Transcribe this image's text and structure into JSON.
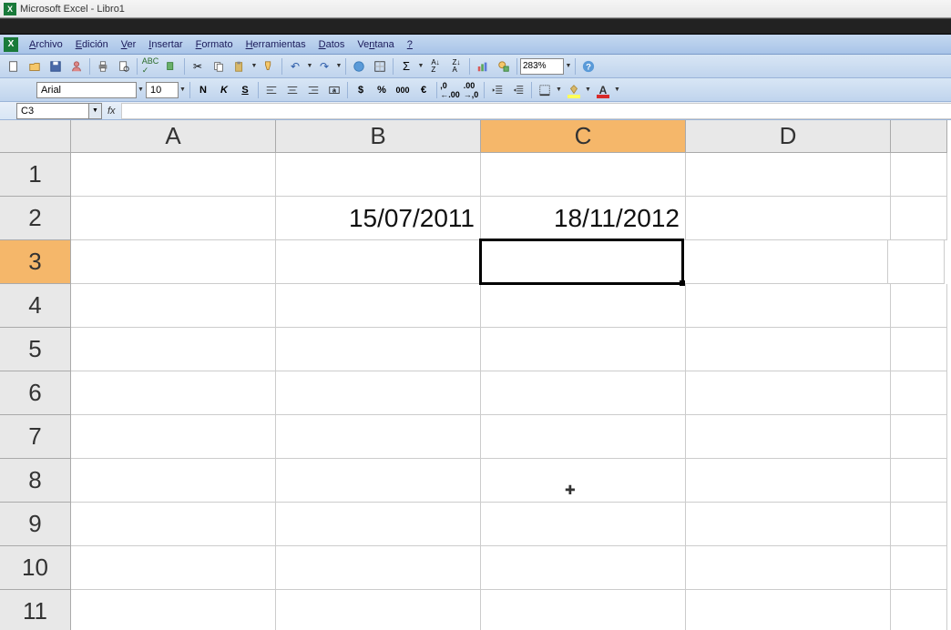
{
  "title": "Microsoft Excel - Libro1",
  "menus": [
    "Archivo",
    "Edición",
    "Ver",
    "Insertar",
    "Formato",
    "Herramientas",
    "Datos",
    "Ventana",
    "?"
  ],
  "zoom": "283%",
  "font": "Arial",
  "font_size": "10",
  "name_box": "C3",
  "formula": "",
  "columns": [
    "A",
    "B",
    "C",
    "D",
    ""
  ],
  "selected_col": "C",
  "selected_row": 3,
  "rows": [
    1,
    2,
    3,
    4,
    5,
    6,
    7,
    8,
    9,
    10,
    11
  ],
  "cells": {
    "B2": "15/07/2011",
    "C2": "18/11/2012"
  },
  "selected_cell": "C3",
  "fmt": {
    "bold": "N",
    "italic": "K",
    "underline": "S",
    "currency": "$",
    "percent": "%",
    "thousands": "000",
    "euro": "€"
  }
}
